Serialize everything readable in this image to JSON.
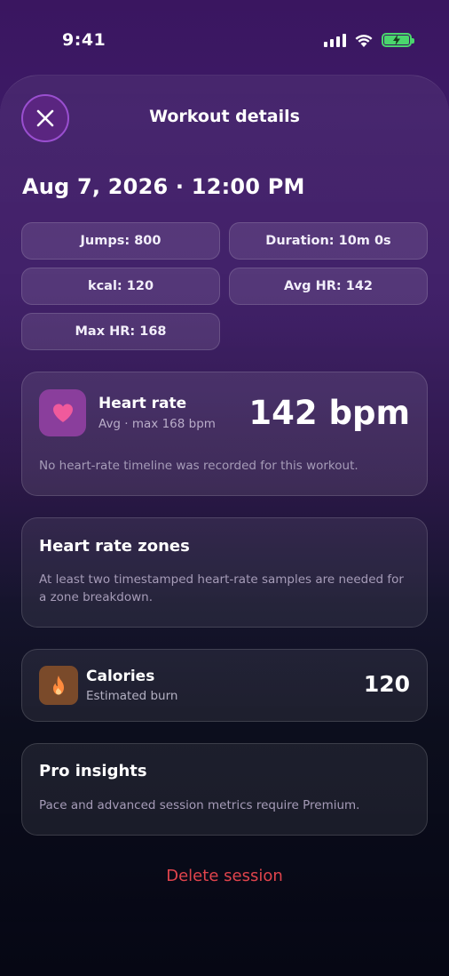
{
  "status_bar": {
    "time": "9:41"
  },
  "header": {
    "title": "Workout details"
  },
  "session": {
    "date": "Aug 7, 2026 · 12:00 PM"
  },
  "stats": {
    "jumps": "Jumps: 800",
    "duration": "Duration: 10m 0s",
    "kcal": "kcal: 120",
    "avg_hr": "Avg HR: 142",
    "max_hr": "Max HR: 168"
  },
  "heart_rate": {
    "title": "Heart rate",
    "subtitle": "Avg · max 168 bpm",
    "value": "142 bpm",
    "note": "No heart-rate timeline was recorded for this workout.",
    "icon": "heart-icon",
    "accent": "#f05a9c"
  },
  "zones": {
    "title": "Heart rate zones",
    "note": "At least two timestamped heart-rate samples are needed for a zone breakdown."
  },
  "calories": {
    "title": "Calories",
    "subtitle": "Estimated burn",
    "value": "120",
    "icon": "flame-icon",
    "accent": "#ff8a3d"
  },
  "pro": {
    "title": "Pro insights",
    "note": "Pace and advanced session metrics require Premium."
  },
  "actions": {
    "delete_label": "Delete session",
    "delete_color": "#e0444c"
  }
}
